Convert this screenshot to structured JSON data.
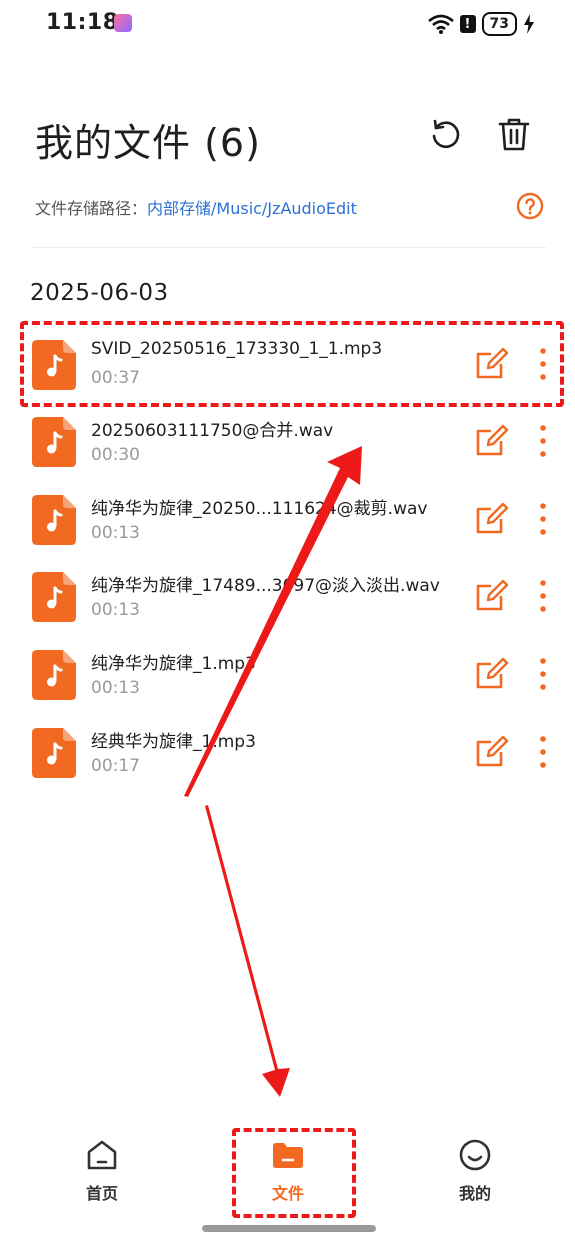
{
  "status_bar": {
    "time": "11:18",
    "battery": "73",
    "alert": "!"
  },
  "header": {
    "title": "我的文件 (6)"
  },
  "storage": {
    "label": "文件存储路径：",
    "path": "内部存储/Music/JzAudioEdit"
  },
  "date_group": "2025-06-03",
  "files": [
    {
      "name": "SVID_20250516_173330_1_1.mp3",
      "duration": "00:37"
    },
    {
      "name": "20250603111750@合并.wav",
      "duration": "00:30"
    },
    {
      "name": "纯净华为旋律_20250...111624@裁剪.wav",
      "duration": "00:13"
    },
    {
      "name": "纯净华为旋律_17489...3097@淡入淡出.wav",
      "duration": "00:13"
    },
    {
      "name": "纯净华为旋律_1.mp3",
      "duration": "00:13"
    },
    {
      "name": "经典华为旋律_1.mp3",
      "duration": "00:17"
    }
  ],
  "nav": {
    "home": "首页",
    "files": "文件",
    "me": "我的"
  },
  "colors": {
    "accent": "#f26a21",
    "link": "#2d6fd6",
    "annotation": "#ee1a1a"
  },
  "icons": [
    "refresh-icon",
    "trash-icon",
    "help-icon",
    "music-file-icon",
    "edit-icon",
    "more-vertical-icon",
    "home-icon",
    "folder-icon",
    "smile-icon"
  ]
}
